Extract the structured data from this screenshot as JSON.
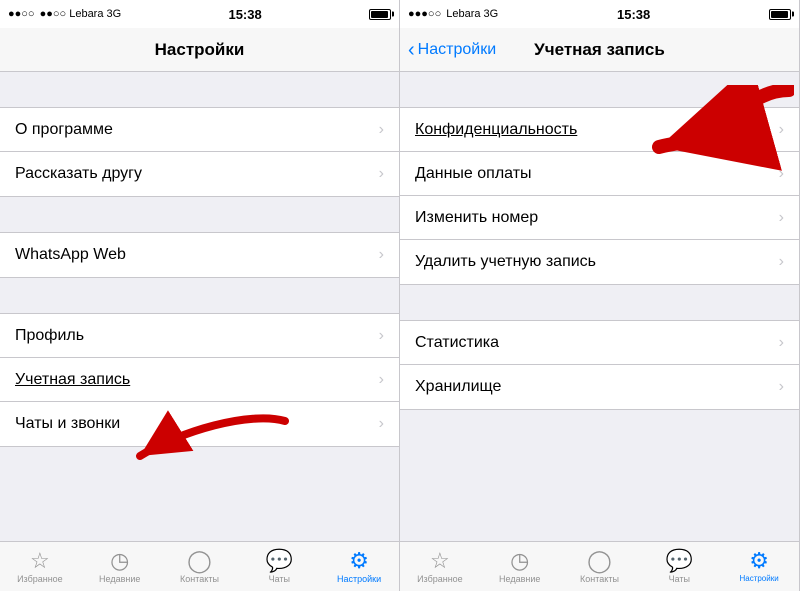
{
  "panel1": {
    "statusBar": {
      "carrier": "●●○○ Lebara  3G",
      "time": "15:38"
    },
    "navTitle": "Настройки",
    "sections": [
      {
        "items": [
          {
            "label": "О программе",
            "chevron": "›"
          },
          {
            "label": "Рассказать другу",
            "chevron": "›"
          }
        ]
      },
      {
        "items": [
          {
            "label": "WhatsApp Web",
            "chevron": "›"
          }
        ]
      },
      {
        "items": [
          {
            "label": "Профиль",
            "chevron": "›"
          },
          {
            "label": "Учетная запись",
            "chevron": "›",
            "underline": true
          },
          {
            "label": "Чаты и звонки",
            "chevron": "›"
          }
        ]
      }
    ],
    "tabs": [
      {
        "icon": "☆",
        "label": "Избранное",
        "active": false
      },
      {
        "icon": "◷",
        "label": "Недавние",
        "active": false
      },
      {
        "icon": "👤",
        "label": "Контакты",
        "active": false
      },
      {
        "icon": "💬",
        "label": "Чаты",
        "active": false
      },
      {
        "icon": "⚙",
        "label": "Настройки",
        "active": true
      }
    ]
  },
  "panel2": {
    "statusBar": {
      "carrier": "●●●○○ Lebara  3G",
      "time": "15:38"
    },
    "navBack": "Настройки",
    "navTitle": "Учетная запись",
    "sections": [
      {
        "items": [
          {
            "label": "Конфиденциальность",
            "chevron": "›",
            "underline": true
          },
          {
            "label": "Данные оплаты",
            "chevron": "›"
          },
          {
            "label": "Изменить номер",
            "chevron": "›"
          },
          {
            "label": "Удалить учетную запись",
            "chevron": "›"
          }
        ]
      },
      {
        "items": [
          {
            "label": "Статистика",
            "chevron": "›"
          },
          {
            "label": "Хранилище",
            "chevron": "›"
          }
        ]
      }
    ],
    "tabs": [
      {
        "icon": "☆",
        "label": "Избранное",
        "active": false
      },
      {
        "icon": "◷",
        "label": "Недавние",
        "active": false
      },
      {
        "icon": "👤",
        "label": "Контакты",
        "active": false
      },
      {
        "icon": "💬",
        "label": "Чаты",
        "active": false
      },
      {
        "icon": "⚙",
        "label": "Настройки",
        "active": true
      }
    ]
  }
}
